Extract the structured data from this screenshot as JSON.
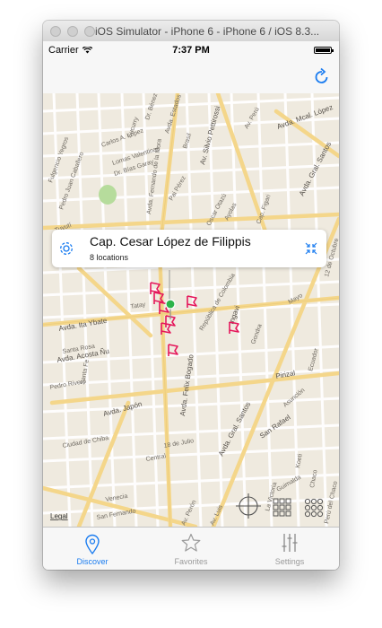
{
  "window": {
    "title": "iOS Simulator - iPhone 6 - iPhone 6 / iOS 8.3..."
  },
  "status_bar": {
    "carrier": "Carrier",
    "time": "7:37 PM"
  },
  "nav": {
    "refresh_icon": "refresh-icon"
  },
  "map": {
    "legal_label": "Legal",
    "streets": [
      "Carlos A. López",
      "Sucurry",
      "Lomas Valentinas",
      "Dr. Bías Garay",
      "Pedro Juan Caballero",
      "Fulgencio Yegros",
      "Dr. Bénez",
      "Brasil",
      "Av. Silvio Pettirossi",
      "Avda. Estados Unidos",
      "Av. Perú",
      "Avda. Mcal. López",
      "Pai Pérez",
      "Oscar Otazú",
      "Ayolas",
      "Avda. Fernando de la Mora",
      "Tuyutí",
      "Cap. Figari",
      "Avda. Gral. Santos",
      "12 de Octubre",
      "Mayo",
      "Avda. Ita Ybate",
      "Avda. Acosta Ñu",
      "Pedro Rivero",
      "Santa Fe",
      "República de Colombia",
      "Ingavi",
      "Gondra",
      "Ecuador",
      "Tatay",
      "Avda. Felix Bogado",
      "Avda. Japón",
      "Pirizal",
      "Asunción",
      "Ciudad de Chiba",
      "18 de Julio",
      "Avda. Gral. Santos",
      "San Rafael",
      "Central",
      "Guimalda",
      "La Victoria",
      "Perú del Chaco",
      "Venecia",
      "San Fernando",
      "Av. Perón",
      "Av. Luis",
      "Koeti",
      "Chaco",
      "Santa Rosa"
    ]
  },
  "callout": {
    "title": "Cap. Cesar López de Filippis",
    "subtitle": "8 locations"
  },
  "tabs": [
    {
      "label": "Discover",
      "icon": "location-pin-icon",
      "active": true
    },
    {
      "label": "Favorites",
      "icon": "star-icon",
      "active": false
    },
    {
      "label": "Settings",
      "icon": "sliders-icon",
      "active": false
    }
  ],
  "colors": {
    "accent": "#1a7cf0",
    "marker": "#e5175b",
    "user_dot": "#2cb34a",
    "road_major": "#f4d68a",
    "map_bg": "#efeadf"
  }
}
